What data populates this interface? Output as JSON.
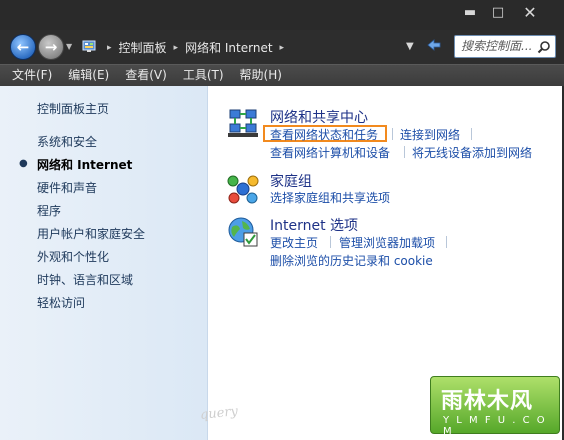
{
  "window": {
    "minimize": "▬",
    "maximize": "□",
    "close": "✕"
  },
  "address": {
    "crumbs": [
      "控制面板",
      "网络和 Internet"
    ],
    "search_placeholder": "搜索控制面..."
  },
  "menu": [
    "文件(F)",
    "编辑(E)",
    "查看(V)",
    "工具(T)",
    "帮助(H)"
  ],
  "sidebar": {
    "items": [
      "控制面板主页",
      "系统和安全",
      "网络和 Internet",
      "硬件和声音",
      "程序",
      "用户帐户和家庭安全",
      "外观和个性化",
      "时钟、语言和区域",
      "轻松访问"
    ],
    "active_index": 2
  },
  "categories": [
    {
      "title": "网络和共享中心",
      "icon": "network-center-icon",
      "links": [
        "查看网络状态和任务",
        "连接到网络",
        "查看网络计算机和设备",
        "将无线设备添加到网络"
      ]
    },
    {
      "title": "家庭组",
      "icon": "homegroup-icon",
      "links": [
        "选择家庭组和共享选项"
      ]
    },
    {
      "title": "Internet 选项",
      "icon": "internet-options-icon",
      "links": [
        "更改主页",
        "管理浏览器加载项",
        "删除浏览的历史记录和 cookie"
      ]
    }
  ],
  "watermark": {
    "text": "query",
    "logo_title": "雨林木风",
    "logo_sub": "Y L M F U . C O M"
  },
  "colors": {
    "link": "#1c4ea8",
    "category_title": "#1e3287",
    "highlight": "#f28a1e",
    "sidebar_text": "#1e395b"
  }
}
